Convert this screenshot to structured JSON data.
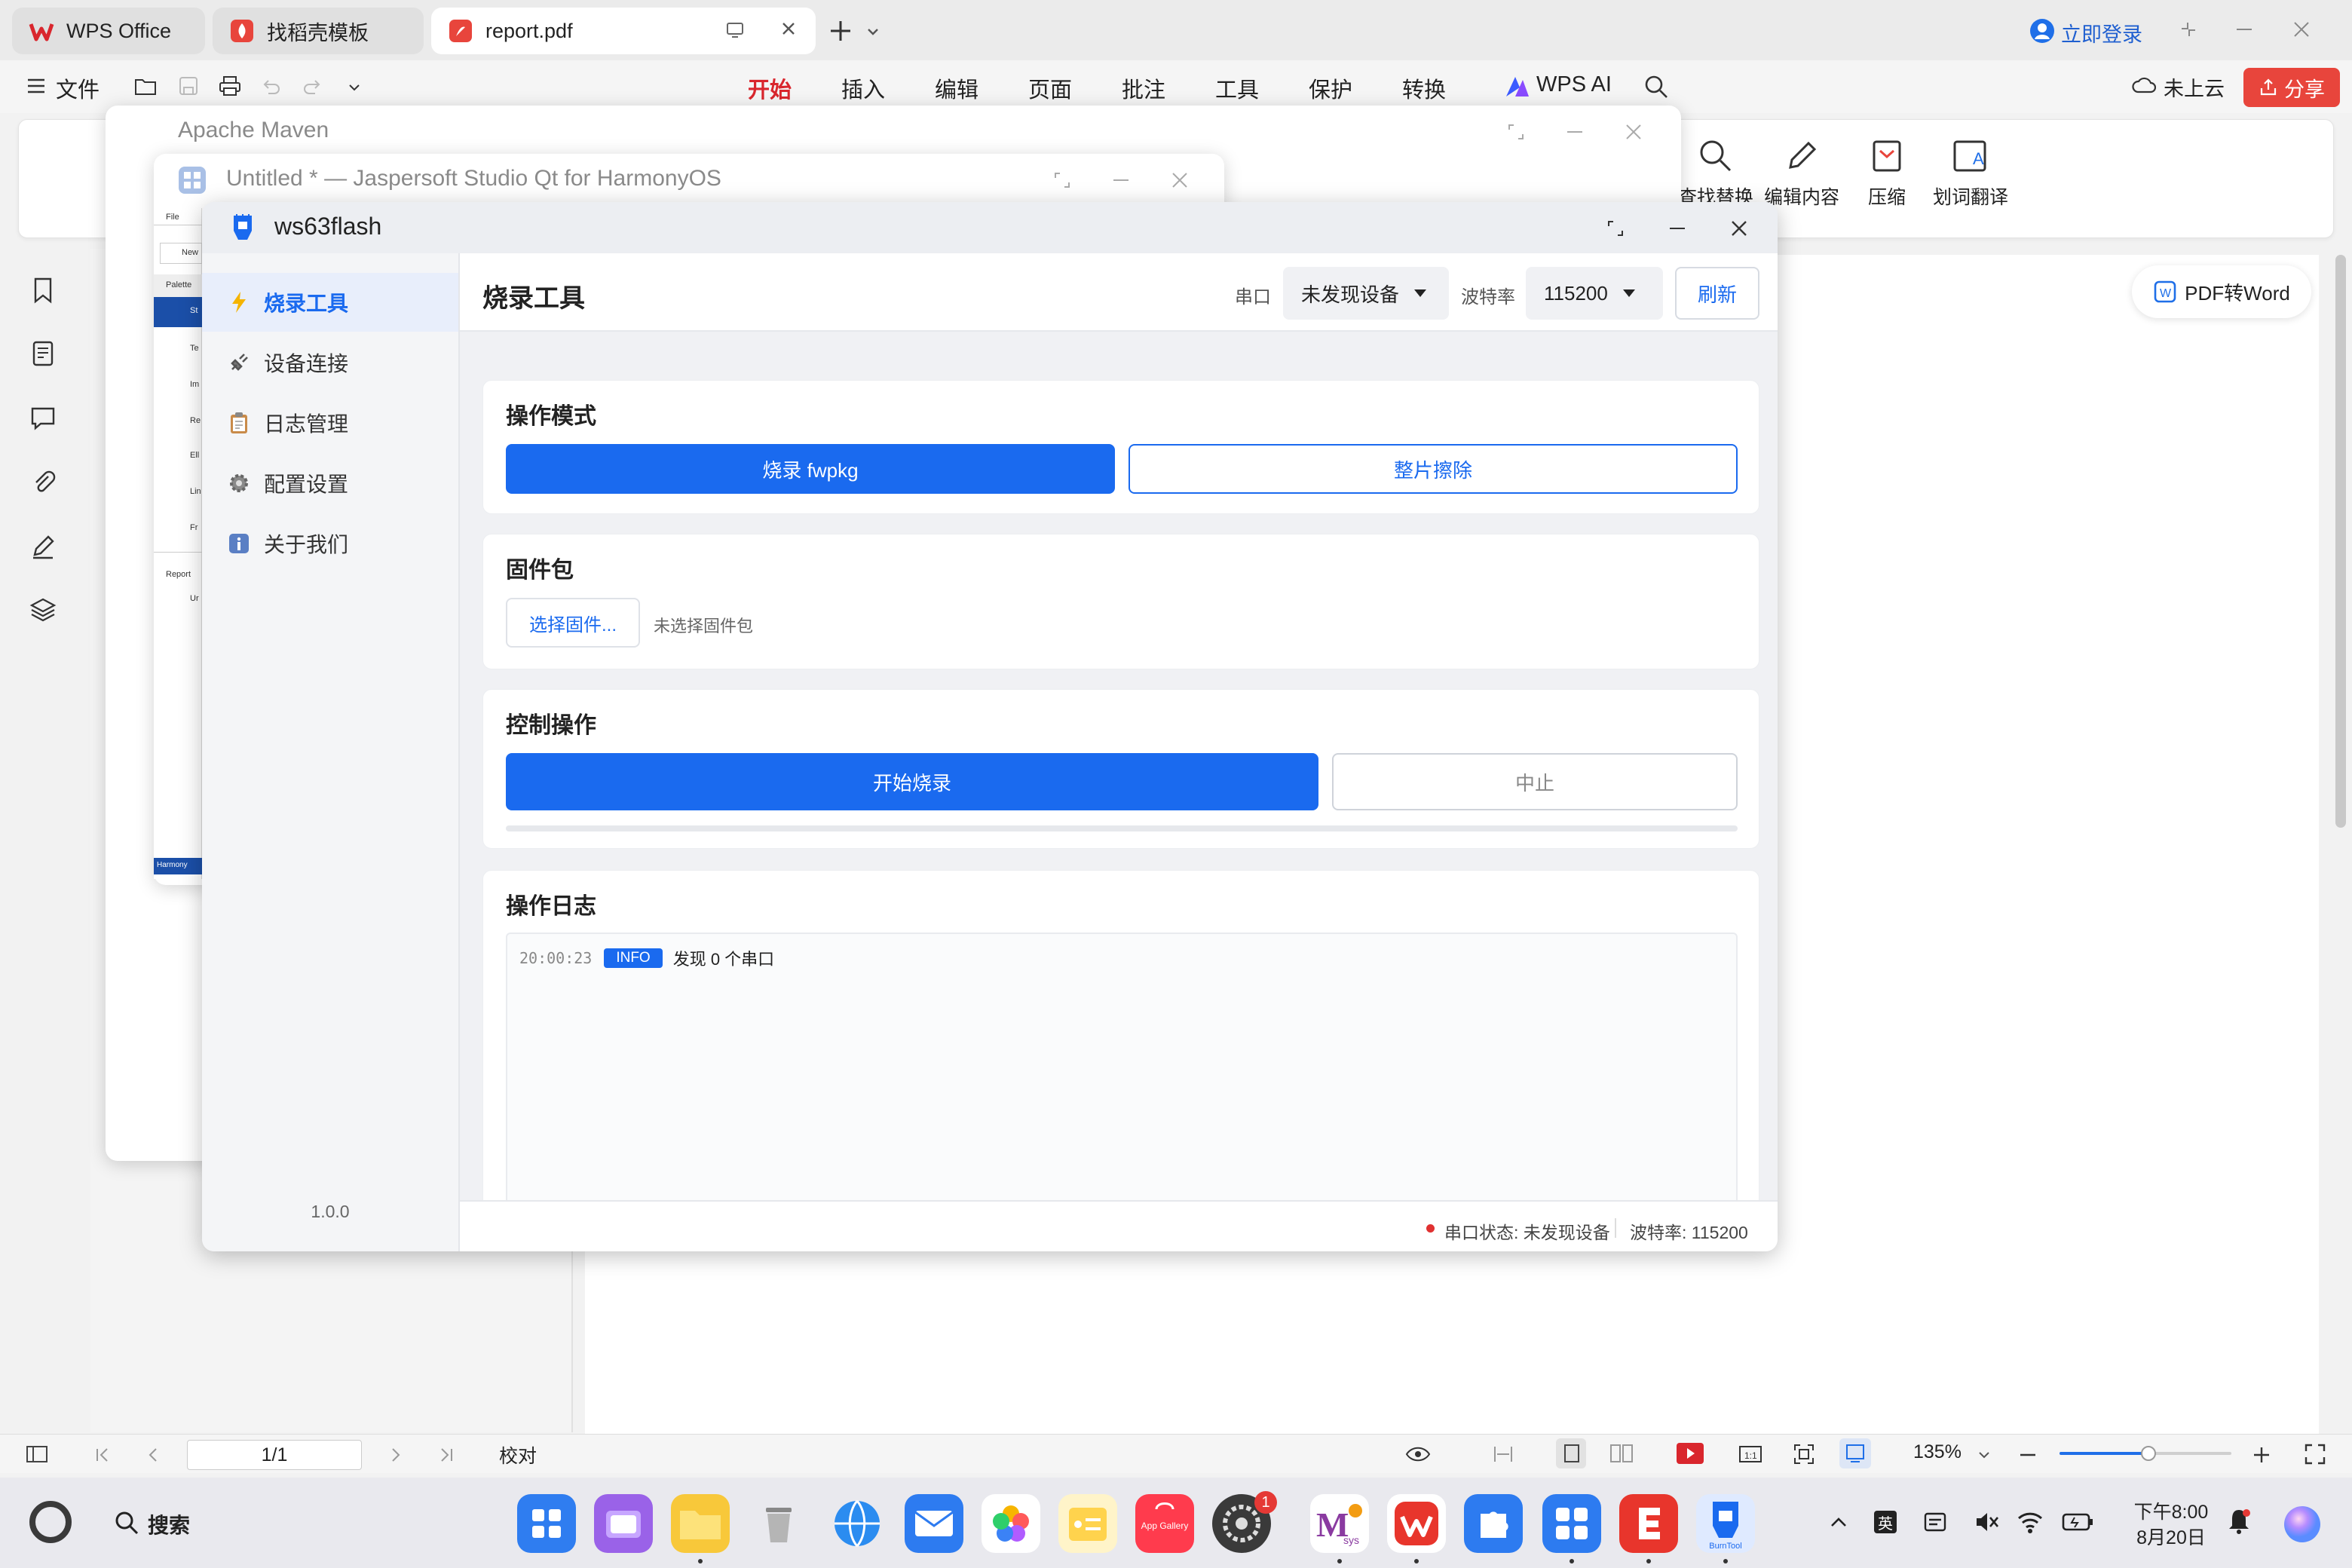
{
  "wps": {
    "tabs": [
      {
        "label": "WPS Office"
      },
      {
        "label": "找稻壳模板"
      },
      {
        "label": "report.pdf"
      }
    ],
    "login": "立即登录",
    "file_menu": "文件",
    "menu_tabs": [
      "开始",
      "插入",
      "编辑",
      "页面",
      "批注",
      "工具",
      "保护",
      "转换"
    ],
    "wps_ai": "WPS AI",
    "cloud": "未上云",
    "share": "分享",
    "ribbon": [
      "查找替换",
      "编辑内容",
      "压缩",
      "划词翻译"
    ],
    "pdf_to_word": "PDF转Word",
    "status": {
      "page": "1/1",
      "proof": "校对",
      "zoom": "135%"
    }
  },
  "maven": {
    "title": "Apache Maven"
  },
  "jasper": {
    "title": "Untitled * — Jaspersoft Studio Qt for HarmonyOS",
    "file_menu": "File",
    "items": [
      "New",
      "Palette",
      "St",
      "Te",
      "Im",
      "Re",
      "Ell",
      "Lin",
      "Fr",
      "Report",
      "Ur",
      "Harmony"
    ]
  },
  "app": {
    "title": "ws63flash",
    "version": "1.0.0",
    "nav": [
      {
        "label": "烧录工具",
        "icon": "lightning-icon",
        "active": true
      },
      {
        "label": "设备连接",
        "icon": "plug-icon"
      },
      {
        "label": "日志管理",
        "icon": "clipboard-icon"
      },
      {
        "label": "配置设置",
        "icon": "gear-icon"
      },
      {
        "label": "关于我们",
        "icon": "info-icon"
      }
    ],
    "header": {
      "title": "烧录工具",
      "port_label": "串口",
      "port_value": "未发现设备",
      "baud_label": "波特率",
      "baud_value": "115200",
      "refresh": "刷新"
    },
    "mode": {
      "title": "操作模式",
      "flash_btn": "烧录 fwpkg",
      "erase_btn": "整片擦除"
    },
    "firmware": {
      "title": "固件包",
      "choose_btn": "选择固件...",
      "none_text": "未选择固件包"
    },
    "control": {
      "title": "控制操作",
      "start_btn": "开始烧录",
      "stop_btn": "中止",
      "progress": 0
    },
    "log": {
      "title": "操作日志",
      "entries": [
        {
          "time": "20:00:23",
          "level": "INFO",
          "message": "发现 0 个串口"
        }
      ]
    },
    "status": {
      "port_status": "串口状态: 未发现设备",
      "baud_status": "波特率: 115200"
    },
    "colors": {
      "accent": "#1a6aef",
      "status_dot": "#e03131"
    }
  },
  "taskbar": {
    "search": "搜索",
    "ime": "英",
    "time": "下午8:00",
    "date": "8月20日",
    "badge": "1",
    "dock": [
      "launcher-icon",
      "multitask-icon",
      "files-icon",
      "trash-icon",
      "browser-icon",
      "mail-icon",
      "photos-icon",
      "notes-icon",
      "appgallery-icon",
      "settings-icon",
      "msys2-icon",
      "wps-icon",
      "puzzle-icon",
      "grid-app-icon",
      "e-app-icon",
      "burntool-icon"
    ],
    "appgallery_label": "App Gallery",
    "msys_label": "sys",
    "burntool_label": "BurnTool"
  }
}
